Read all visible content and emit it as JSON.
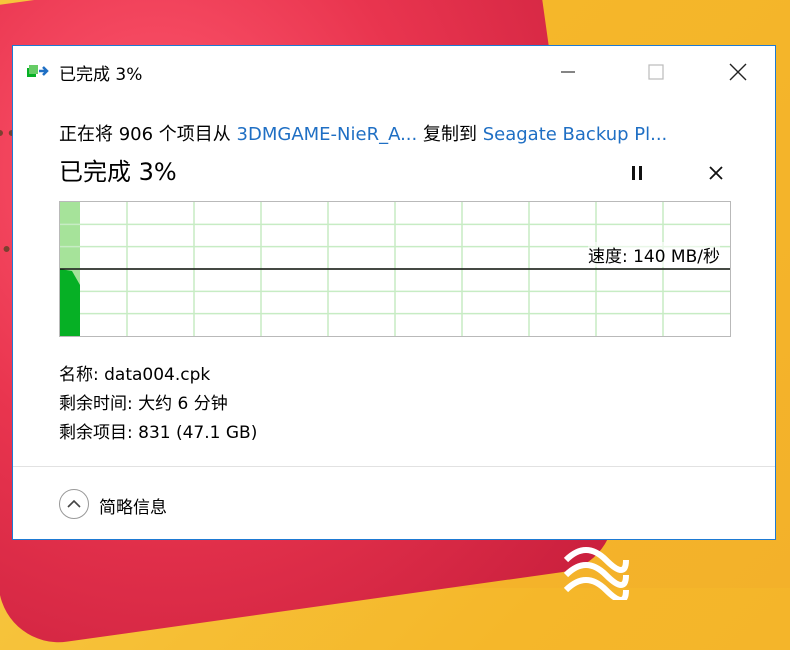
{
  "window": {
    "title": "已完成 3%",
    "minimize_icon": "minimize-icon",
    "maximize_icon": "maximize-icon",
    "close_icon": "close-icon"
  },
  "copy": {
    "prefix": "正在将 906 个项目从 ",
    "source": "3DMGAME-NieR_A...",
    "middle": " 复制到 ",
    "destination": "Seagate Backup Pl..."
  },
  "progress": {
    "title": "已完成 3%",
    "percent": 3,
    "pause_icon": "pause-icon",
    "cancel_icon": "close-icon"
  },
  "graph": {
    "speed_label": "速度: 140 MB/秒",
    "fill_color": "#06b025",
    "completed_bg": "#a6e39a",
    "grid_color": "#c7ecc4"
  },
  "details": {
    "name_line": "名称: data004.cpk",
    "time_line": "剩余时间: 大约 6 分钟",
    "items_line": "剩余项目: 831 (47.1 GB)"
  },
  "footer": {
    "toggle_label": "简略信息",
    "toggle_icon": "chevron-up-icon"
  }
}
